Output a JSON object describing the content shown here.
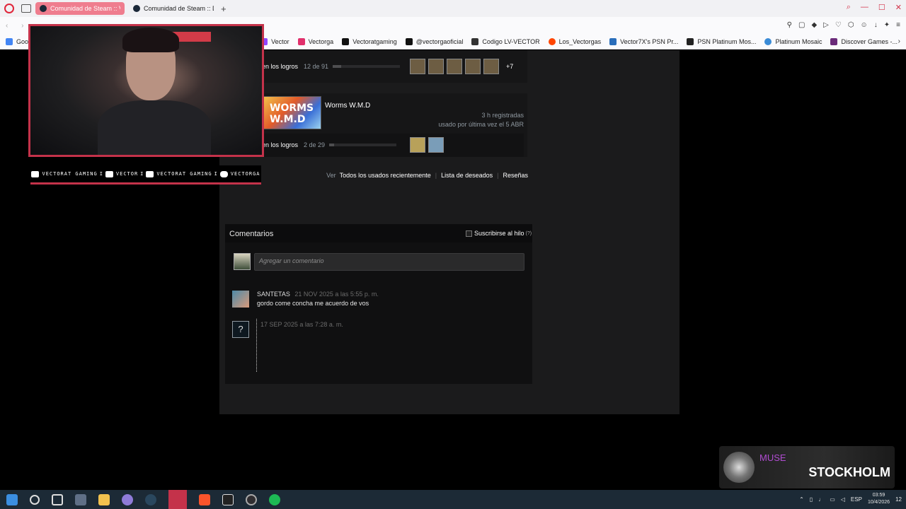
{
  "browser": {
    "tabs": [
      {
        "title": "Comunidad de Steam :: Vec",
        "active": true
      },
      {
        "title": "Comunidad de Steam :: Dy",
        "active": false
      }
    ],
    "bookmarks": [
      {
        "label": "Goo"
      },
      {
        "label": "Vector",
        "color": "#9146ff"
      },
      {
        "label": "Vectorga",
        "color": "#e1306c"
      },
      {
        "label": "Vectoratgaming",
        "color": "#111111"
      },
      {
        "label": "@vectorgaoficial",
        "color": "#111111"
      },
      {
        "label": "Codigo LV-VECTOR",
        "color": "#333333"
      },
      {
        "label": "Los_Vectorgas",
        "color": "#ff4500"
      },
      {
        "label": "Vector7X's PSN Pr...",
        "color": "#2a6ebb"
      },
      {
        "label": "PSN Platinum Mos...",
        "color": "#222222"
      },
      {
        "label": "Platinum Mosaic",
        "color": "#3a8bd6"
      },
      {
        "label": "Discover Games -...",
        "color": "#6b2b7a"
      }
    ]
  },
  "game1": {
    "achievements_label": "en los logros",
    "achievements_count": "12 de 91",
    "progress": 0.13,
    "more": "+7"
  },
  "game2": {
    "title": "Worms W.M.D",
    "logo_text": "WORMS W.M.D",
    "hours": "3 h registradas",
    "last_played": "usado por última vez el 5 ABR",
    "achievements_label": "en los logros",
    "achievements_count": "2 de 29",
    "progress": 0.07
  },
  "profile_links": {
    "ver": "Ver",
    "recent": "Todos los usados recientemente",
    "wishlist": "Lista de deseados",
    "reviews": "Reseñas"
  },
  "comments": {
    "title": "Comentarios",
    "subscribe": "Suscribirse al hilo",
    "help": "(?)",
    "placeholder": "Agregar un comentario",
    "items": [
      {
        "author": "SANTETAS",
        "date": "21 NOV 2025 a las 5:55 p. m.",
        "text": "gordo come concha me acuerdo de vos"
      },
      {
        "author": "",
        "date": "17 SEP 2025 a las 7:28 a. m.",
        "text": "",
        "avatar_glyph": "?"
      }
    ]
  },
  "stream": {
    "socials": [
      "VECTORAT GAMING",
      "VECTOR",
      "VECTORAT GAMING",
      "VECTORGA"
    ],
    "separator": "I"
  },
  "music": {
    "artist": "MUSE",
    "track": "STOCKHOLM"
  },
  "taskbar": {
    "lang": "ESP",
    "time": "03:59",
    "date": "10/4/2026",
    "notifications": "12"
  }
}
